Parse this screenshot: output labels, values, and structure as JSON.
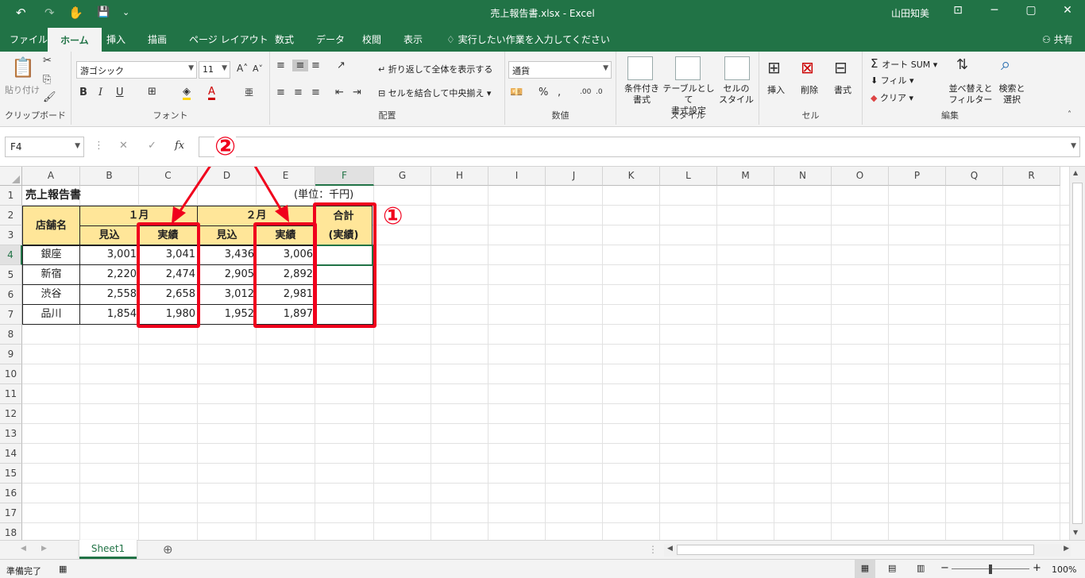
{
  "window": {
    "doc_title": "売上報告書.xlsx  -  Excel",
    "user": "山田知美",
    "controls": [
      "─",
      "▢",
      "✕"
    ]
  },
  "quick_access": [
    "↶",
    "↷",
    "✋",
    "💾",
    "⌄"
  ],
  "tabs": [
    "ファイル",
    "ホーム",
    "挿入",
    "描画",
    "ページ レイアウト",
    "数式",
    "データ",
    "校閲",
    "表示"
  ],
  "tell_me": "実行したい作業を入力してください",
  "share": "共有",
  "ribbon": {
    "clipboard": {
      "label": "クリップボード",
      "paste": "貼り付け"
    },
    "font": {
      "label": "フォント",
      "name": "游ゴシック",
      "size": "11",
      "bold": "B",
      "italic": "I",
      "underline": "U"
    },
    "alignment": {
      "label": "配置",
      "wrap": "折り返して全体を表示する",
      "merge": "セルを結合して中央揃え"
    },
    "number": {
      "label": "数値",
      "format": "通貨",
      "percent": "%",
      "comma": ","
    },
    "styles": {
      "label": "スタイル",
      "cond1": "条件付き",
      "cond2": "書式",
      "table1": "テーブルとして",
      "table2": "書式設定",
      "cell1": "セルの",
      "cell2": "スタイル"
    },
    "cells": {
      "label": "セル",
      "insert": "挿入",
      "delete": "削除",
      "format": "書式"
    },
    "editing": {
      "label": "編集",
      "autosum": "オート SUM",
      "fill": "フィル",
      "clear": "クリア",
      "sort1": "並べ替えと",
      "sort2": "フィルター",
      "find1": "検索と",
      "find2": "選択"
    }
  },
  "formula_bar": {
    "name_box": "F4",
    "cancel": "✕",
    "enter": "✓",
    "fx": "fx",
    "value": ""
  },
  "columns": [
    "A",
    "B",
    "C",
    "D",
    "E",
    "F",
    "G",
    "H",
    "I",
    "J",
    "K",
    "L",
    "M",
    "N",
    "O",
    "P",
    "Q",
    "R"
  ],
  "rows": [
    "1",
    "2",
    "3",
    "4",
    "5",
    "6",
    "7",
    "8",
    "9",
    "10",
    "11",
    "12",
    "13",
    "14",
    "15",
    "16",
    "17",
    "18"
  ],
  "selected_cell": {
    "col": "F",
    "row": "4"
  },
  "sheet": {
    "title": "売上報告書",
    "unit": "(単位：千円)",
    "store_header": "店舗名",
    "month1": "１月",
    "month2": "２月",
    "total_header1": "合計",
    "total_header2": "(実績)",
    "plan_label": "見込",
    "actual_label": "実績",
    "stores": [
      {
        "name": "銀座",
        "m1_plan": "3,001",
        "m1_actual": "3,041",
        "m2_plan": "3,436",
        "m2_actual": "3,006"
      },
      {
        "name": "新宿",
        "m1_plan": "2,220",
        "m1_actual": "2,474",
        "m2_plan": "2,905",
        "m2_actual": "2,892"
      },
      {
        "name": "渋谷",
        "m1_plan": "2,558",
        "m1_actual": "2,658",
        "m2_plan": "3,012",
        "m2_actual": "2,981"
      },
      {
        "name": "品川",
        "m1_plan": "1,854",
        "m1_actual": "1,980",
        "m2_plan": "1,952",
        "m2_actual": "1,897"
      }
    ]
  },
  "annotations": {
    "marker1": "①",
    "marker2": "②",
    "color": "#f0001c"
  },
  "sheet_tabs": [
    {
      "name": "Sheet1",
      "active": true
    }
  ],
  "add_sheet": "⊕",
  "status": {
    "ready": "準備完了",
    "zoom": "100%"
  },
  "colors": {
    "excel_green": "#217346",
    "header_fill": "#ffe699",
    "annotation_red": "#f0001c"
  }
}
